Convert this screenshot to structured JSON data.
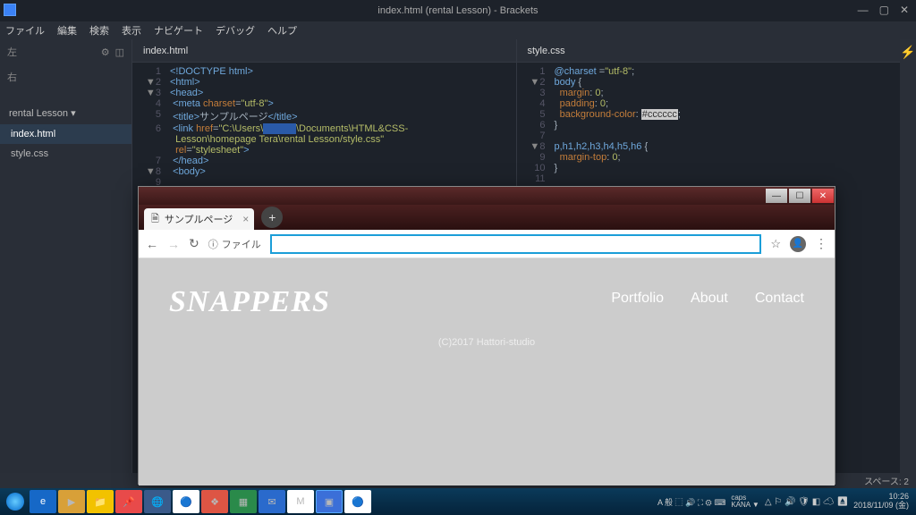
{
  "titlebar": {
    "text": "index.html (rental Lesson) - Brackets"
  },
  "menubar": [
    "ファイル",
    "編集",
    "検索",
    "表示",
    "ナビゲート",
    "デバッグ",
    "ヘルプ"
  ],
  "sidebar": {
    "left": "左",
    "right": "右",
    "project": "rental Lesson ▾",
    "files": [
      {
        "name": "index.html",
        "active": true
      },
      {
        "name": "style.css",
        "active": false
      }
    ]
  },
  "editor_left": {
    "tab": "index.html",
    "lines": [
      {
        "n": "1",
        "html": "<span class='tag'>&lt;!DOCTYPE html&gt;</span>"
      },
      {
        "n": "2",
        "fold": "▼",
        "html": "<span class='tag'>&lt;html&gt;</span>"
      },
      {
        "n": "3",
        "fold": "▼",
        "html": "<span class='tag'>&lt;head&gt;</span>"
      },
      {
        "n": "4",
        "html": " <span class='tag'>&lt;meta</span> <span class='attr'>charset</span>=<span class='str'>\"utf-8\"</span><span class='tag'>&gt;</span>"
      },
      {
        "n": "5",
        "html": " <span class='tag'>&lt;title&gt;</span>サンプルページ<span class='tag'>&lt;/title&gt;</span>"
      },
      {
        "n": "6",
        "html": " <span class='tag'>&lt;link</span> <span class='attr'>href</span>=<span class='str'>\"C:\\Users\\<span style='background:#2a5aa8;color:#2a5aa8'>______</span>\\Documents\\HTML&amp;CSS-</span>"
      },
      {
        "n": "",
        "html": "  <span class='str'>Lesson\\homepage Tera\\rental Lesson/style.css\"</span>"
      },
      {
        "n": "",
        "html": "  <span class='attr'>rel</span>=<span class='str'>\"stylesheet\"</span><span class='tag'>&gt;</span>"
      },
      {
        "n": "7",
        "html": " <span class='tag'>&lt;/head&gt;</span>"
      },
      {
        "n": "8",
        "fold": "▼",
        "html": " <span class='tag'>&lt;body&gt;</span>"
      },
      {
        "n": "9",
        "html": ""
      }
    ]
  },
  "editor_right": {
    "tab": "style.css",
    "lines": [
      {
        "n": "1",
        "html": "<span class='sel'>@charset</span> =<span class='str'>\"utf-8\"</span>;"
      },
      {
        "n": "2",
        "fold": "▼",
        "html": "<span class='sel'>body</span> <span class='pun'>{</span>"
      },
      {
        "n": "3",
        "html": "  <span class='prop'>margin</span>: <span class='val'>0</span>;"
      },
      {
        "n": "4",
        "html": "  <span class='prop'>padding</span>: <span class='val'>0</span>;"
      },
      {
        "n": "5",
        "html": "  <span class='prop'>background-color</span>: <span class='hl'>#cccccc</span>;"
      },
      {
        "n": "6",
        "html": "<span class='pun'>}</span>"
      },
      {
        "n": "7",
        "html": ""
      },
      {
        "n": "8",
        "fold": "▼",
        "html": "<span class='sel'>p,h1,h2,h3,h4,h5,h6</span> <span class='pun'>{</span>"
      },
      {
        "n": "9",
        "html": "  <span class='prop'>margin-top</span>: <span class='val'>0</span>;"
      },
      {
        "n": "10",
        "html": "<span class='pun'>}</span>"
      },
      {
        "n": "11",
        "html": ""
      }
    ]
  },
  "browser": {
    "tab_title": "サンプルページ",
    "origin": "ファイル",
    "logo": "SNAPPERS",
    "nav": [
      "Portfolio",
      "About",
      "Contact"
    ],
    "copyright": "(C)2017 Hattori-studio"
  },
  "statusbar": {
    "spaces": "スペース: 2"
  },
  "tray": {
    "ime": "A 般 ⬚ 🔊 ⛶ ⚙ ⌨",
    "caps": "caps\nKANA ▼",
    "icons": "△ ⚐ 🔊 🛡 ◧ ☁ ⏏",
    "time": "10:26",
    "date": "2018/11/09 (金)"
  }
}
